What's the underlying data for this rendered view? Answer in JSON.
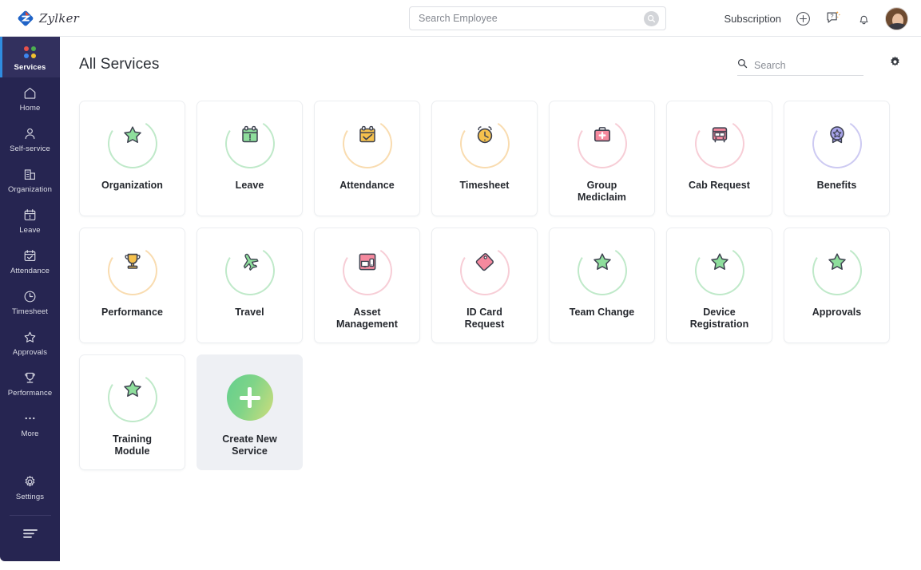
{
  "brand": {
    "name": "Zylker",
    "logo_icon": "zylker-diamond-logo"
  },
  "topbar": {
    "search_placeholder": "Search Employee",
    "search_value": "",
    "search_icon": "search-icon",
    "subscription_label": "Subscription",
    "add_icon": "plus-circle-icon",
    "help_icon": "help-chat-icon",
    "notification_icon": "bell-icon",
    "avatar_icon": "user-avatar"
  },
  "sidebar": {
    "active_item": "Services",
    "accent_color": "#2f8ce0",
    "background_color": "#262551",
    "items": [
      {
        "label": "Services",
        "icon": "services-dots-icon",
        "active": true
      },
      {
        "label": "Home",
        "icon": "home-icon",
        "active": false
      },
      {
        "label": "Self-service",
        "icon": "user-icon",
        "active": false
      },
      {
        "label": "Organization",
        "icon": "building-icon",
        "active": false
      },
      {
        "label": "Leave",
        "icon": "calendar-alert-icon",
        "active": false
      },
      {
        "label": "Attendance",
        "icon": "calendar-check-icon",
        "active": false
      },
      {
        "label": "Timesheet",
        "icon": "clock-icon",
        "active": false
      },
      {
        "label": "Approvals",
        "icon": "star-icon",
        "active": false
      },
      {
        "label": "Performance",
        "icon": "trophy-icon",
        "active": false
      },
      {
        "label": "More",
        "icon": "ellipsis-icon",
        "active": false
      },
      {
        "label": "Settings",
        "icon": "gear-icon",
        "active": false
      }
    ],
    "collapse_icon": "collapse-menu-icon"
  },
  "page": {
    "title": "All Services",
    "search_placeholder": "Search",
    "search_value": "",
    "search_icon": "search-icon",
    "settings_icon": "gear-icon"
  },
  "services": [
    {
      "label": "Organization",
      "icon": "star-icon",
      "color": "#7fd98f",
      "arc": "#bfe9c9"
    },
    {
      "label": "Leave",
      "icon": "calendar-icon",
      "color": "#6fd08b",
      "arc": "#bfe9c9"
    },
    {
      "label": "Attendance",
      "icon": "calendar-check-icon",
      "color": "#f5bf4a",
      "arc": "#f9dcb0"
    },
    {
      "label": "Timesheet",
      "icon": "alarm-clock-icon",
      "color": "#f6c445",
      "arc": "#f9dcb0"
    },
    {
      "label": "Group\nMediclaim",
      "icon": "medical-kit-icon",
      "color": "#f5869c",
      "arc": "#f7cdd6"
    },
    {
      "label": "Cab Request",
      "icon": "bus-icon",
      "color": "#f5879c",
      "arc": "#f7cdd6"
    },
    {
      "label": "Benefits",
      "icon": "award-badge-icon",
      "color": "#a8a4ea",
      "arc": "#cdcaf2"
    },
    {
      "label": "Performance",
      "icon": "trophy-icon",
      "color": "#f6c445",
      "arc": "#f9dcb0"
    },
    {
      "label": "Travel",
      "icon": "airplane-icon",
      "color": "#72d38e",
      "arc": "#bfe9c9"
    },
    {
      "label": "Asset\nManagement",
      "icon": "devices-icon",
      "color": "#f5879c",
      "arc": "#f7cdd6"
    },
    {
      "label": "ID Card\nRequest",
      "icon": "tag-icon",
      "color": "#f5879c",
      "arc": "#f7cdd6"
    },
    {
      "label": "Team Change",
      "icon": "star-icon",
      "color": "#7fd98f",
      "arc": "#bfe9c9"
    },
    {
      "label": "Device\nRegistration",
      "icon": "star-icon",
      "color": "#7fd98f",
      "arc": "#bfe9c9"
    },
    {
      "label": "Approvals",
      "icon": "star-icon",
      "color": "#7fd98f",
      "arc": "#bfe9c9"
    },
    {
      "label": "Training\nModule",
      "icon": "star-icon",
      "color": "#7fd98f",
      "arc": "#bfe9c9"
    }
  ],
  "create_card": {
    "label": "Create New\nService",
    "icon": "plus-icon",
    "gradient_from": "#63cf8e",
    "gradient_to": "#cfdd7c"
  }
}
